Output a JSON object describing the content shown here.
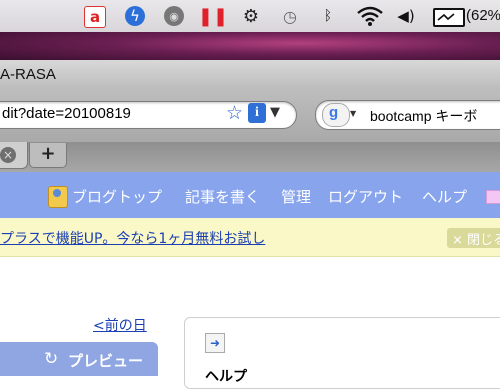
{
  "menubar": {
    "icons": [
      "avira-antivirus-icon",
      "flash-lightning-icon",
      "webcam-icon",
      "pause-icon",
      "sync-gear-icon",
      "time-machine-clock-icon",
      "bluetooth-icon",
      "wifi-icon",
      "volume-icon",
      "battery-icon"
    ],
    "battery_percent": "(62%"
  },
  "window": {
    "title": "A-RASA"
  },
  "toolbar": {
    "url": "dit?date=20100819",
    "search_text": "bootcamp キーボ"
  },
  "tabs": {
    "new_tab_label": "+",
    "close_label": "×"
  },
  "blog_nav": {
    "items": [
      "ブログトップ",
      "記事を書く",
      "管理",
      "ログアウト",
      "ヘルプ"
    ]
  },
  "promo": {
    "text": "プラスで機能UP。今なら1ヶ月無料お試し",
    "close_label": "× 閉じる"
  },
  "content": {
    "prev_day": "<前の日",
    "preview_label": "プレビュー",
    "help_heading": "ヘルプ"
  },
  "colors": {
    "nav_bg": "#87a4ec",
    "promo_bg": "#fbf8c8",
    "link": "#1a3fb3"
  }
}
